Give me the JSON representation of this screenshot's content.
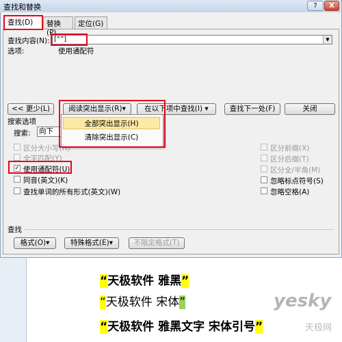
{
  "window": {
    "title": "查找和替换",
    "help_label": "?",
    "close_label": "X"
  },
  "tabs": [
    {
      "label": "查找(D)"
    },
    {
      "label": "替换(P)"
    },
    {
      "label": "定位(G)"
    }
  ],
  "find": {
    "label": "查找内容(N):",
    "value": "[“”]"
  },
  "options": {
    "label": "选项:",
    "value": "使用通配符"
  },
  "buttons": {
    "less": "<< 更少(L)",
    "reading_highlight": "阅读突出显示(R)▾",
    "find_in": "在以下项中查找(I) ▾",
    "find_next": "查找下一处(F)",
    "close": "关闭"
  },
  "menu": {
    "highlight_all": "全部突出显示(H)",
    "clear_highlight": "清除突出显示(C)"
  },
  "search_options": {
    "title": "搜索选项",
    "search_label": "搜索:",
    "search_value": "向下",
    "left": [
      {
        "label": "区分大小写(H)",
        "checked": false,
        "disabled": true
      },
      {
        "label": "全字匹配(Y)",
        "checked": false,
        "disabled": true
      },
      {
        "label": "使用通配符(U)",
        "checked": true,
        "disabled": false
      },
      {
        "label": "同音(英文)(K)",
        "checked": false,
        "disabled": false
      },
      {
        "label": "查找单词的所有形式(英文)(W)",
        "checked": false,
        "disabled": false
      }
    ],
    "right": [
      {
        "label": "区分前缀(X)",
        "checked": false,
        "disabled": true
      },
      {
        "label": "区分后缀(T)",
        "checked": false,
        "disabled": true
      },
      {
        "label": "区分全/半角(M)",
        "checked": false,
        "disabled": true
      },
      {
        "label": "忽略标点符号(S)",
        "checked": false,
        "disabled": false
      },
      {
        "label": "忽略空格(A)",
        "checked": false,
        "disabled": false
      }
    ]
  },
  "find_section": {
    "title": "查找",
    "format": "格式(O)▾",
    "special": "特殊格式(E)▾",
    "no_format": "不限定格式(T)"
  },
  "document": {
    "lines": [
      {
        "open": "“",
        "text": "天极软件  雅黑",
        "close": "”"
      },
      {
        "open": "“",
        "text": "天极软件 宋体",
        "close": "”"
      },
      {
        "open": "“",
        "text": "天极软件  雅黑文字  宋体引号",
        "close": "”"
      }
    ],
    "watermark": "yesky",
    "watermark_sub": "天极网"
  },
  "colors": {
    "highlight": "#ffff00",
    "annotation": "#e8001c"
  }
}
